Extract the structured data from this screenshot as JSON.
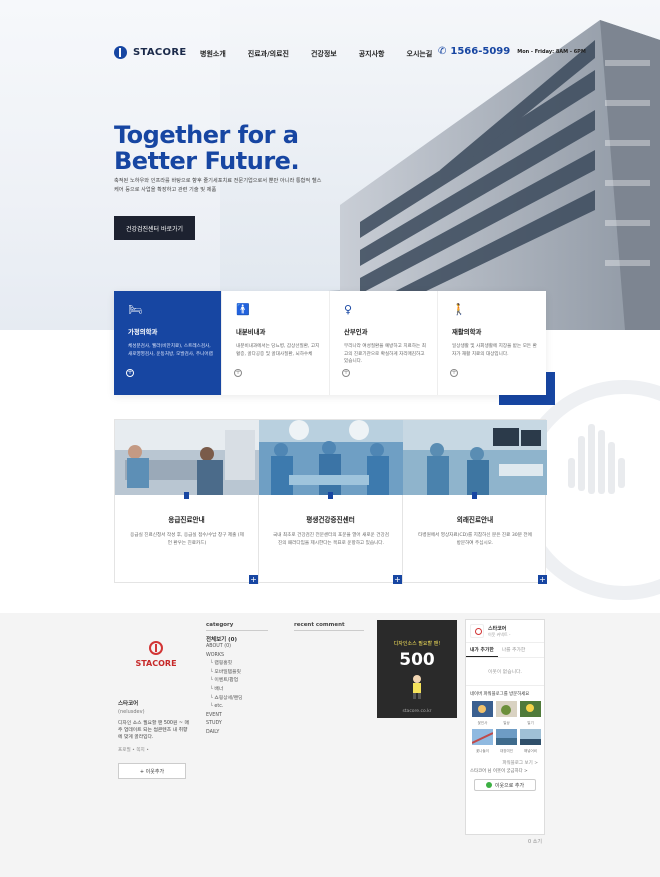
{
  "nav": {
    "logo": "STACORE",
    "menu": [
      "병원소개",
      "진료과/의료진",
      "건강정보",
      "공지사항",
      "오시는길"
    ],
    "phone": "1566-5099",
    "hours": "Mon - Friday: 8AM - 6PM"
  },
  "hero": {
    "headline": "Together for a Better Future.",
    "subcopy": "축적된 노하우와 인프라를 바탕으로 향후 줄기세포치료 전문기업으로서 뿐만 아니라 통합적 헬스케어 등으로 사업을 확장하고 관련 기술 및 제품",
    "button": "건강검진센터 바로가기"
  },
  "services": [
    {
      "icon": "bed-icon",
      "title": "가정의학과",
      "desc": "체성분검사, 웰라(비만치료), 스트레스검사, 새로영영검사, 운동처방, 모발검사, 주니어랩",
      "active": true
    },
    {
      "icon": "person-icon",
      "title": "내분비내과",
      "desc": "내분비내과에서는 당뇨병, 갑상선질환, 고지혈증, 골다공증 및 골대사질환, 뇌하수체",
      "active": false
    },
    {
      "icon": "pregnant-icon",
      "title": "산부인과",
      "desc": "무리나라 여성질환을 예방하고 치료하는 최고의 진료기관으로 확실하게 자리매김하고 있습니다.",
      "active": false
    },
    {
      "icon": "walk-icon",
      "title": "재활의학과",
      "desc": "일상생활 및 사회생활에 지장을 받는 모든 환자가 재활 치료의 대상입니다.",
      "active": false
    }
  ],
  "centers": [
    {
      "title": "응급진료안내",
      "desc": "응급실 진료신청서 작성 후, 응급실 접수/수납 창구 제출 (제언 환우는 진료카드)"
    },
    {
      "title": "평생건강증진센터",
      "desc": "국내 최초로 건강검진 전문센터의 포문을 열어 새로운 건강검진의 패러다임을 제시한다는 목표로 운항하고 있습니다."
    },
    {
      "title": "외래진료안내",
      "desc": "타병원에서 영상자료(CD)를 지참하신 분은 진료 30분 전에 방문하여 주십시오."
    }
  ],
  "profile": {
    "logo": "STACORE",
    "nick": "스타코어",
    "id": "(nelusdev)",
    "text": "디자인 소스 필요할 땐 500원 ~ 매주 업데이트 되는 썸콘텐츠 내 취향에 맞게 골라입다.",
    "links": "프로필 • 쪽지 •",
    "add": "+ 이웃추가"
  },
  "category": {
    "head": "category",
    "all": "전체보기 (0)",
    "items": [
      {
        "label": "ABOUT (0)",
        "sub": false
      },
      {
        "label": "WORKS",
        "sub": false
      },
      {
        "label": "랩핑홈힛",
        "sub": true
      },
      {
        "label": "모바일템플릿",
        "sub": true
      },
      {
        "label": "이벤트/팝업",
        "sub": true
      },
      {
        "label": "배너",
        "sub": true
      },
      {
        "label": "쇼핑상세/랜딩",
        "sub": true
      },
      {
        "label": "etc.",
        "sub": true
      },
      {
        "label": "EVENT",
        "sub": false
      },
      {
        "label": "STUDY",
        "sub": false
      },
      {
        "label": "DAILY",
        "sub": false
      }
    ]
  },
  "recent": {
    "head": "recent comment"
  },
  "ad": {
    "top": "디자인소스 필요할 땐!",
    "num": "500",
    "url": "stacore.co.kr"
  },
  "side": {
    "name": "스타코어",
    "sub": "이웃 커넥트 -",
    "tab_on": "내가 추가한",
    "tab_off": "나를 추가한",
    "empty": "이웃이 없습니다.",
    "group": "네이버 파워블로그를 방문하세요",
    "thumbs": [
      "꽃인사",
      "일상",
      "일기",
      "꽃나들이",
      "대장미인",
      "해넣어비"
    ],
    "more": "파워블로그 보기 >",
    "foot": "스타코어 님 이웃이 궁금하다 >",
    "btn": "이웃으로 추가"
  },
  "tiny": "0 소기"
}
